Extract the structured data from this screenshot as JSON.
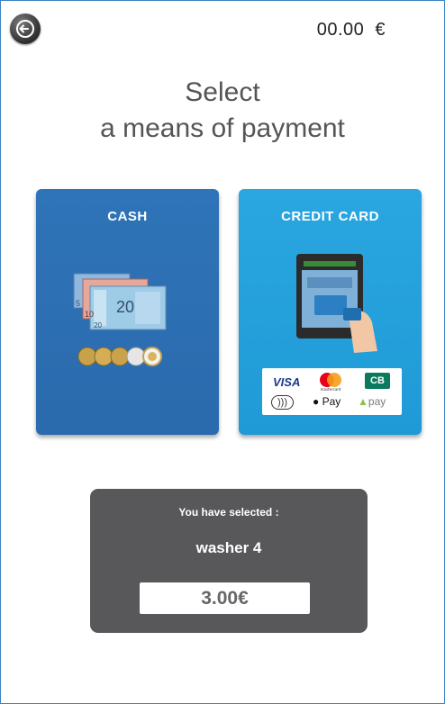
{
  "header": {
    "back_icon": "back-arrow-icon",
    "balance": "00.00  €"
  },
  "title": {
    "line1": "Select",
    "line2": "a means of payment"
  },
  "payment_options": [
    {
      "label": "CASH",
      "icon": "cash-banknotes-coins-icon"
    },
    {
      "label": "CREDIT CARD",
      "icon": "payment-terminal-icon",
      "logos": [
        "VISA",
        "mastercard",
        "CB",
        "contactless",
        "Pay",
        "pay"
      ]
    }
  ],
  "selection": {
    "label": "You have selected :",
    "item": "washer 4",
    "price": "3.00€"
  },
  "colors": {
    "cash_card": "#2f74b8",
    "credit_card": "#2aa6e0",
    "panel": "#58585a"
  }
}
